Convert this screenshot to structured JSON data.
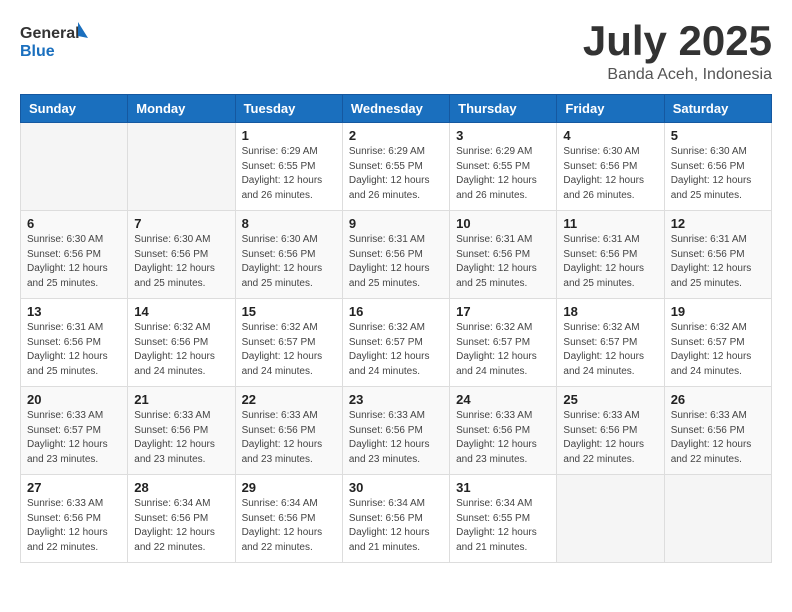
{
  "logo": {
    "general": "General",
    "blue": "Blue"
  },
  "title": {
    "month": "July 2025",
    "location": "Banda Aceh, Indonesia"
  },
  "weekdays": [
    "Sunday",
    "Monday",
    "Tuesday",
    "Wednesday",
    "Thursday",
    "Friday",
    "Saturday"
  ],
  "weeks": [
    [
      {
        "day": "",
        "info": ""
      },
      {
        "day": "",
        "info": ""
      },
      {
        "day": "1",
        "info": "Sunrise: 6:29 AM\nSunset: 6:55 PM\nDaylight: 12 hours and 26 minutes."
      },
      {
        "day": "2",
        "info": "Sunrise: 6:29 AM\nSunset: 6:55 PM\nDaylight: 12 hours and 26 minutes."
      },
      {
        "day": "3",
        "info": "Sunrise: 6:29 AM\nSunset: 6:55 PM\nDaylight: 12 hours and 26 minutes."
      },
      {
        "day": "4",
        "info": "Sunrise: 6:30 AM\nSunset: 6:56 PM\nDaylight: 12 hours and 26 minutes."
      },
      {
        "day": "5",
        "info": "Sunrise: 6:30 AM\nSunset: 6:56 PM\nDaylight: 12 hours and 25 minutes."
      }
    ],
    [
      {
        "day": "6",
        "info": "Sunrise: 6:30 AM\nSunset: 6:56 PM\nDaylight: 12 hours and 25 minutes."
      },
      {
        "day": "7",
        "info": "Sunrise: 6:30 AM\nSunset: 6:56 PM\nDaylight: 12 hours and 25 minutes."
      },
      {
        "day": "8",
        "info": "Sunrise: 6:30 AM\nSunset: 6:56 PM\nDaylight: 12 hours and 25 minutes."
      },
      {
        "day": "9",
        "info": "Sunrise: 6:31 AM\nSunset: 6:56 PM\nDaylight: 12 hours and 25 minutes."
      },
      {
        "day": "10",
        "info": "Sunrise: 6:31 AM\nSunset: 6:56 PM\nDaylight: 12 hours and 25 minutes."
      },
      {
        "day": "11",
        "info": "Sunrise: 6:31 AM\nSunset: 6:56 PM\nDaylight: 12 hours and 25 minutes."
      },
      {
        "day": "12",
        "info": "Sunrise: 6:31 AM\nSunset: 6:56 PM\nDaylight: 12 hours and 25 minutes."
      }
    ],
    [
      {
        "day": "13",
        "info": "Sunrise: 6:31 AM\nSunset: 6:56 PM\nDaylight: 12 hours and 25 minutes."
      },
      {
        "day": "14",
        "info": "Sunrise: 6:32 AM\nSunset: 6:56 PM\nDaylight: 12 hours and 24 minutes."
      },
      {
        "day": "15",
        "info": "Sunrise: 6:32 AM\nSunset: 6:57 PM\nDaylight: 12 hours and 24 minutes."
      },
      {
        "day": "16",
        "info": "Sunrise: 6:32 AM\nSunset: 6:57 PM\nDaylight: 12 hours and 24 minutes."
      },
      {
        "day": "17",
        "info": "Sunrise: 6:32 AM\nSunset: 6:57 PM\nDaylight: 12 hours and 24 minutes."
      },
      {
        "day": "18",
        "info": "Sunrise: 6:32 AM\nSunset: 6:57 PM\nDaylight: 12 hours and 24 minutes."
      },
      {
        "day": "19",
        "info": "Sunrise: 6:32 AM\nSunset: 6:57 PM\nDaylight: 12 hours and 24 minutes."
      }
    ],
    [
      {
        "day": "20",
        "info": "Sunrise: 6:33 AM\nSunset: 6:57 PM\nDaylight: 12 hours and 23 minutes."
      },
      {
        "day": "21",
        "info": "Sunrise: 6:33 AM\nSunset: 6:56 PM\nDaylight: 12 hours and 23 minutes."
      },
      {
        "day": "22",
        "info": "Sunrise: 6:33 AM\nSunset: 6:56 PM\nDaylight: 12 hours and 23 minutes."
      },
      {
        "day": "23",
        "info": "Sunrise: 6:33 AM\nSunset: 6:56 PM\nDaylight: 12 hours and 23 minutes."
      },
      {
        "day": "24",
        "info": "Sunrise: 6:33 AM\nSunset: 6:56 PM\nDaylight: 12 hours and 23 minutes."
      },
      {
        "day": "25",
        "info": "Sunrise: 6:33 AM\nSunset: 6:56 PM\nDaylight: 12 hours and 22 minutes."
      },
      {
        "day": "26",
        "info": "Sunrise: 6:33 AM\nSunset: 6:56 PM\nDaylight: 12 hours and 22 minutes."
      }
    ],
    [
      {
        "day": "27",
        "info": "Sunrise: 6:33 AM\nSunset: 6:56 PM\nDaylight: 12 hours and 22 minutes."
      },
      {
        "day": "28",
        "info": "Sunrise: 6:34 AM\nSunset: 6:56 PM\nDaylight: 12 hours and 22 minutes."
      },
      {
        "day": "29",
        "info": "Sunrise: 6:34 AM\nSunset: 6:56 PM\nDaylight: 12 hours and 22 minutes."
      },
      {
        "day": "30",
        "info": "Sunrise: 6:34 AM\nSunset: 6:56 PM\nDaylight: 12 hours and 21 minutes."
      },
      {
        "day": "31",
        "info": "Sunrise: 6:34 AM\nSunset: 6:55 PM\nDaylight: 12 hours and 21 minutes."
      },
      {
        "day": "",
        "info": ""
      },
      {
        "day": "",
        "info": ""
      }
    ]
  ]
}
